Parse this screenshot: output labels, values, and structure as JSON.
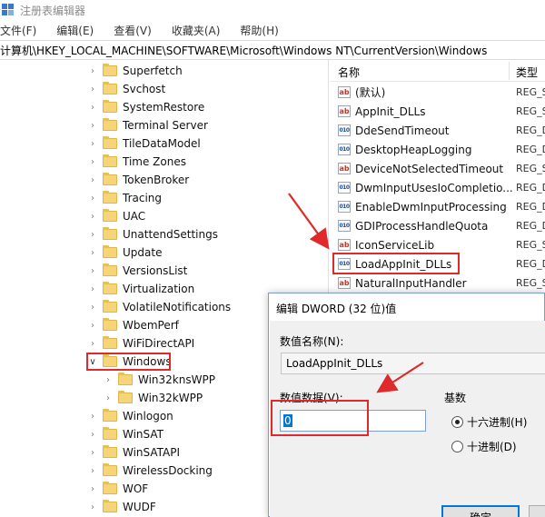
{
  "window": {
    "title": "注册表编辑器"
  },
  "menu": [
    "文件(F)",
    "编辑(E)",
    "查看(V)",
    "收藏夹(A)",
    "帮助(H)"
  ],
  "address": "计算机\\HKEY_LOCAL_MACHINE\\SOFTWARE\\Microsoft\\Windows NT\\CurrentVersion\\Windows",
  "tree": {
    "items": [
      {
        "label": "Superfetch",
        "level": 1,
        "expanded": false
      },
      {
        "label": "Svchost",
        "level": 1,
        "expanded": false
      },
      {
        "label": "SystemRestore",
        "level": 1,
        "expanded": false
      },
      {
        "label": "Terminal Server",
        "level": 1,
        "expanded": false
      },
      {
        "label": "TileDataModel",
        "level": 1,
        "expanded": false
      },
      {
        "label": "Time Zones",
        "level": 1,
        "expanded": false
      },
      {
        "label": "TokenBroker",
        "level": 1,
        "expanded": false
      },
      {
        "label": "Tracing",
        "level": 1,
        "expanded": false
      },
      {
        "label": "UAC",
        "level": 1,
        "expanded": false
      },
      {
        "label": "UnattendSettings",
        "level": 1,
        "expanded": false
      },
      {
        "label": "Update",
        "level": 1,
        "expanded": false
      },
      {
        "label": "VersionsList",
        "level": 1,
        "expanded": false
      },
      {
        "label": "Virtualization",
        "level": 1,
        "expanded": false
      },
      {
        "label": "VolatileNotifications",
        "level": 1,
        "expanded": false
      },
      {
        "label": "WbemPerf",
        "level": 1,
        "expanded": false
      },
      {
        "label": "WiFiDirectAPI",
        "level": 1,
        "expanded": false
      },
      {
        "label": "Windows",
        "level": 1,
        "expanded": true
      },
      {
        "label": "Win32knsWPP",
        "level": 2,
        "expanded": false
      },
      {
        "label": "Win32kWPP",
        "level": 2,
        "expanded": false
      },
      {
        "label": "Winlogon",
        "level": 1,
        "expanded": false
      },
      {
        "label": "WinSAT",
        "level": 1,
        "expanded": false
      },
      {
        "label": "WinSATAPI",
        "level": 1,
        "expanded": false
      },
      {
        "label": "WirelessDocking",
        "level": 1,
        "expanded": false
      },
      {
        "label": "WOF",
        "level": 1,
        "expanded": false
      },
      {
        "label": "WUDF",
        "level": 1,
        "expanded": false
      }
    ]
  },
  "values_pane": {
    "col_name": "名称",
    "col_type": "类型",
    "rows": [
      {
        "name": "(默认)",
        "icon": "ab",
        "type": "REG_S"
      },
      {
        "name": "AppInit_DLLs",
        "icon": "ab",
        "type": "REG_S"
      },
      {
        "name": "DdeSendTimeout",
        "icon": "bin",
        "type": "REG_D"
      },
      {
        "name": "DesktopHeapLogging",
        "icon": "bin",
        "type": "REG_D"
      },
      {
        "name": "DeviceNotSelectedTimeout",
        "icon": "ab",
        "type": "REG_S"
      },
      {
        "name": "DwmInputUsesIoCompletio...",
        "icon": "bin",
        "type": "REG_D"
      },
      {
        "name": "EnableDwmInputProcessing",
        "icon": "bin",
        "type": "REG_D"
      },
      {
        "name": "GDIProcessHandleQuota",
        "icon": "bin",
        "type": "REG_D"
      },
      {
        "name": "IconServiceLib",
        "icon": "ab",
        "type": "REG_S"
      },
      {
        "name": "LoadAppInit_DLLs",
        "icon": "bin",
        "type": "REG_D"
      },
      {
        "name": "NaturalInputHandler",
        "icon": "ab",
        "type": "REG_S"
      }
    ]
  },
  "dialog": {
    "title": "编辑 DWORD (32 位)值",
    "name_label": "数值名称(N):",
    "name_value": "LoadAppInit_DLLs",
    "data_label": "数值数据(V):",
    "data_value": "0",
    "base_label": "基数",
    "hex_label": "十六进制(H)",
    "dec_label": "十进制(D)",
    "base_selected": "hex",
    "ok_label": "确定"
  },
  "colors": {
    "annotation": "#e0292a",
    "accent": "#0078d7"
  }
}
